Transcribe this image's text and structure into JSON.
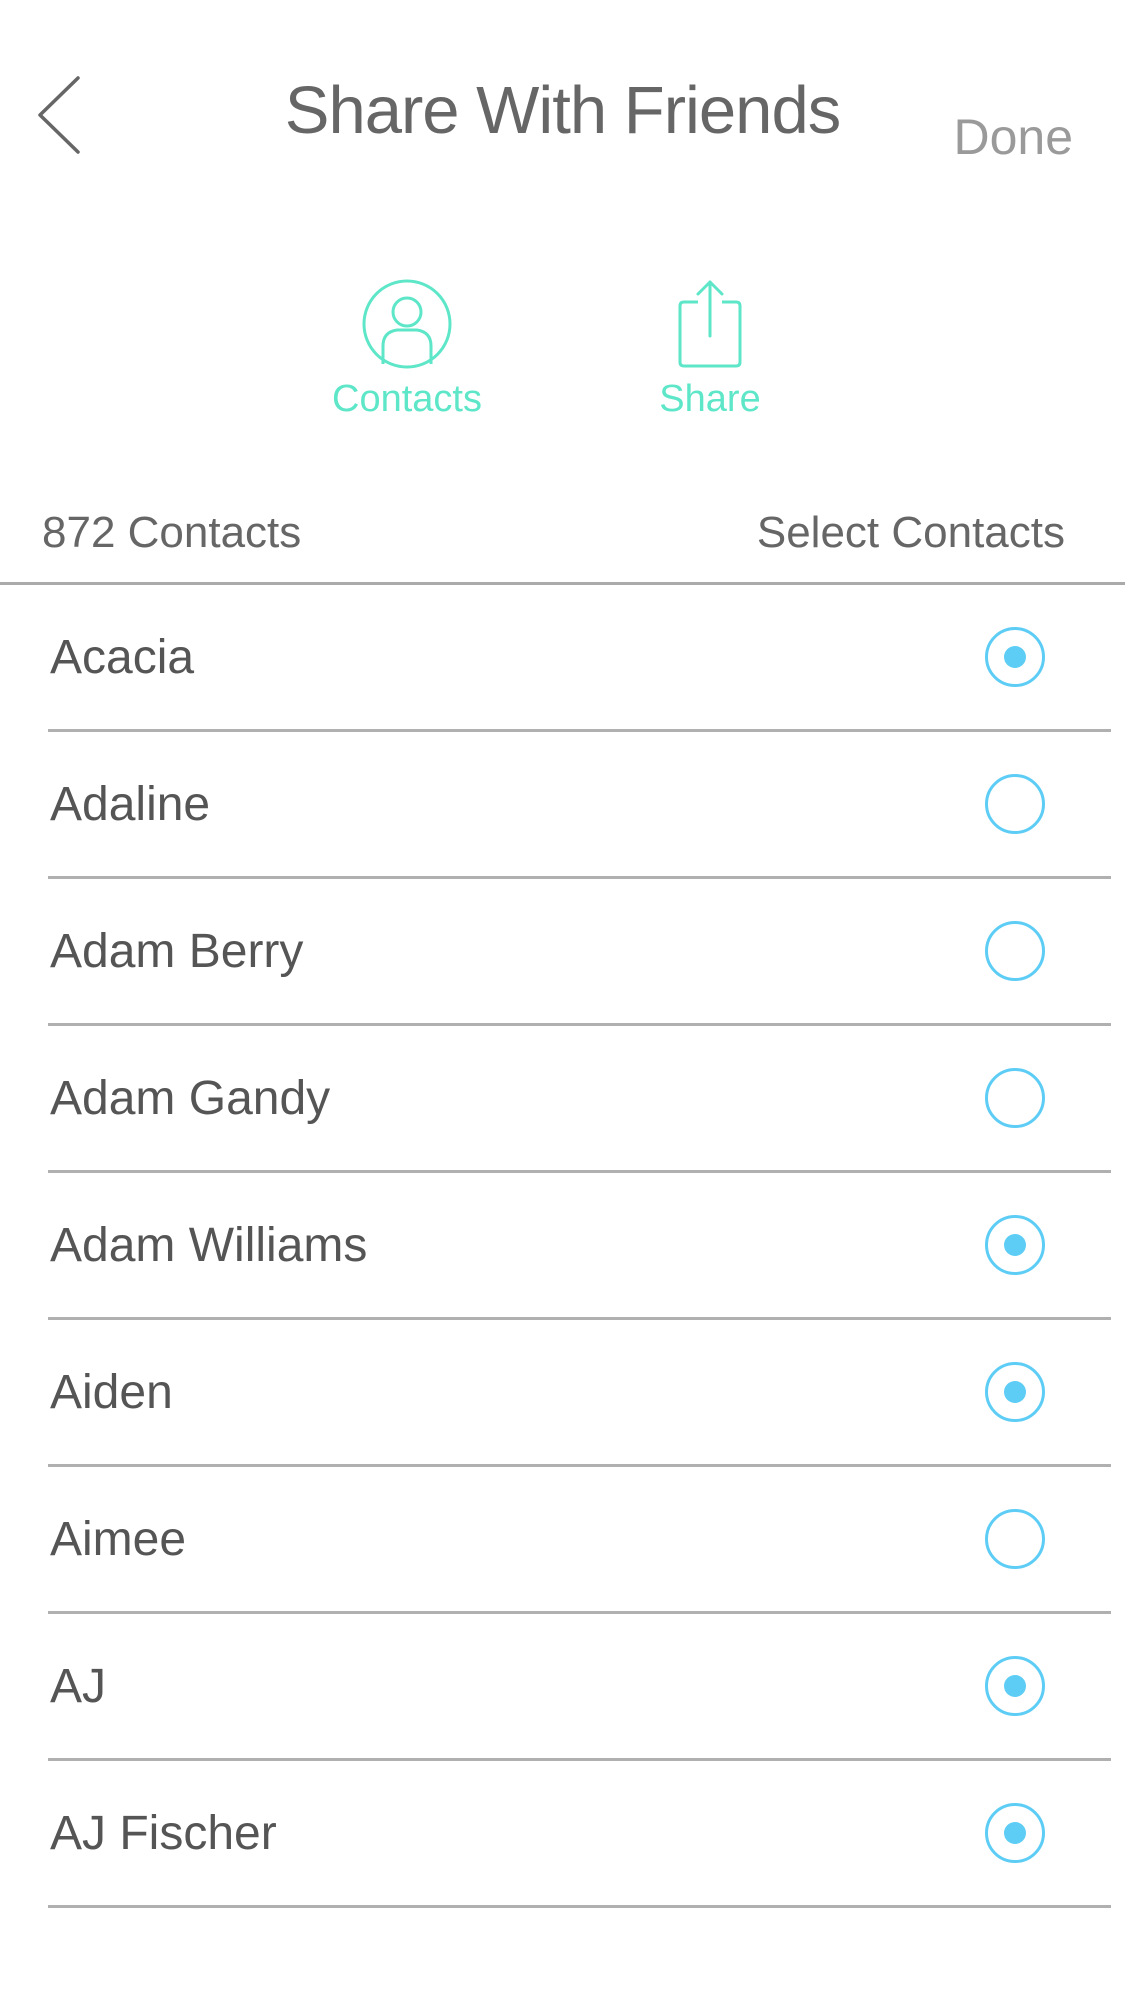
{
  "header": {
    "title": "Share With Friends",
    "done_label": "Done"
  },
  "actions": {
    "contacts_label": "Contacts",
    "share_label": "Share"
  },
  "section": {
    "count_label": "872 Contacts",
    "select_label": "Select Contacts"
  },
  "contacts": [
    {
      "name": "Acacia",
      "selected": true
    },
    {
      "name": "Adaline",
      "selected": false
    },
    {
      "name": "Adam Berry",
      "selected": false
    },
    {
      "name": "Adam Gandy",
      "selected": false
    },
    {
      "name": "Adam Williams",
      "selected": true
    },
    {
      "name": "Aiden",
      "selected": true
    },
    {
      "name": "Aimee",
      "selected": false
    },
    {
      "name": "AJ",
      "selected": true
    },
    {
      "name": "AJ Fischer",
      "selected": true
    }
  ],
  "colors": {
    "accent_green": "#5ee6c8",
    "radio_blue": "#5ecdf5",
    "text_gray": "#666666",
    "divider_gray": "#b0b0b0"
  },
  "icons": {
    "back": "chevron-left-icon",
    "contacts": "person-circle-icon",
    "share": "share-upload-icon",
    "radio": "radio-button-icon"
  }
}
